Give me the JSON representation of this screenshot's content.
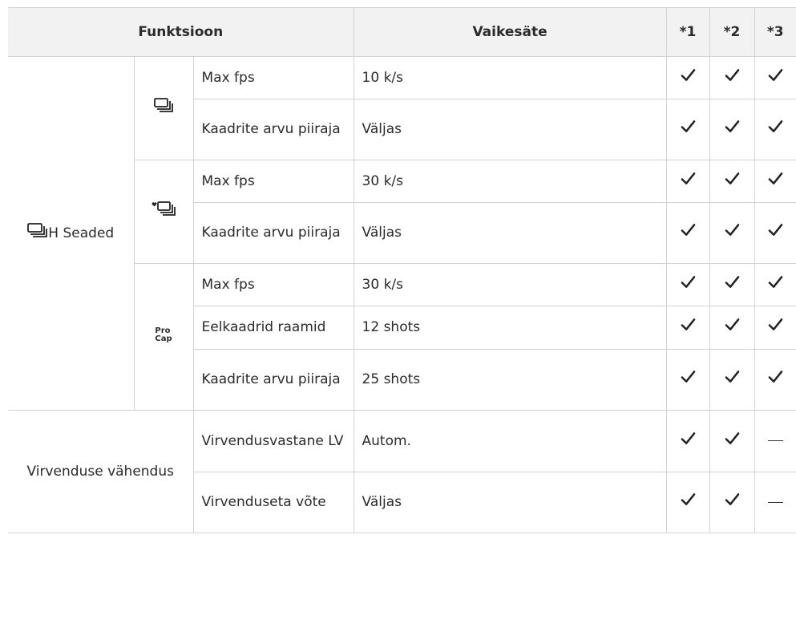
{
  "header": {
    "function": "Funktsioon",
    "default": "Vaikesäte",
    "c1": "*1",
    "c2": "*2",
    "c3": "*3"
  },
  "groups": {
    "burst": "H Seaded",
    "flicker": "Virvenduse vähendus"
  },
  "icons": {
    "sequential": "sequential-high-icon",
    "pro_top": "Pro",
    "pro_bottom": "Cap",
    "check": "checkmark-icon",
    "dash": "dash-icon"
  },
  "rows": [
    {
      "name": "Max fps",
      "value": "10 k/s",
      "marks": [
        "check",
        "check",
        "check"
      ]
    },
    {
      "name": "Kaadrite arvu piiraja",
      "value": "Väljas",
      "marks": [
        "check",
        "check",
        "check"
      ]
    },
    {
      "name": "Max fps",
      "value": "30 k/s",
      "marks": [
        "check",
        "check",
        "check"
      ]
    },
    {
      "name": "Kaadrite arvu piiraja",
      "value": "Väljas",
      "marks": [
        "check",
        "check",
        "check"
      ]
    },
    {
      "name": "Max fps",
      "value": "30 k/s",
      "marks": [
        "check",
        "check",
        "check"
      ]
    },
    {
      "name": "Eelkaadrid raamid",
      "value": "12 shots",
      "marks": [
        "check",
        "check",
        "check"
      ]
    },
    {
      "name": "Kaadrite arvu piiraja",
      "value": "25 shots",
      "marks": [
        "check",
        "check",
        "check"
      ]
    },
    {
      "name": "Virvendusvastane LV",
      "value": "Autom.",
      "marks": [
        "check",
        "check",
        "dash"
      ]
    },
    {
      "name": "Virvenduseta võte",
      "value": "Väljas",
      "marks": [
        "check",
        "check",
        "dash"
      ]
    }
  ]
}
